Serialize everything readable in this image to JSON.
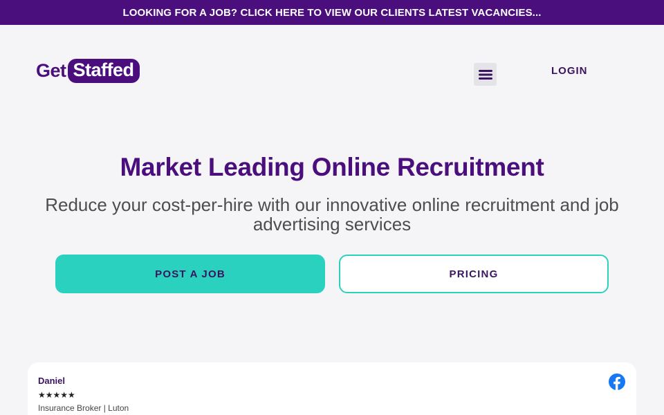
{
  "topbar": {
    "text": "LOOKING FOR A JOB? CLICK HERE TO VIEW OUR CLIENTS LATEST VACANCIES..."
  },
  "header": {
    "logo_part1": "Get",
    "logo_part2": "Staffed",
    "menu_icon": "hamburger-icon",
    "login_label": "LOGIN"
  },
  "hero": {
    "title": "Market Leading Online Recruitment",
    "subtitle": "Reduce your cost-per-hire with our innovative online recruitment and job advertising services",
    "primary_button": "POST A JOB",
    "secondary_button": "PRICING"
  },
  "review": {
    "name": "Daniel",
    "stars": "★★★★★",
    "role": "Insurance Broker | Luton",
    "source_icon": "facebook-icon"
  },
  "colors": {
    "brand_purple": "#4a0f7d",
    "accent_teal": "#2ad1bf",
    "facebook_blue": "#1877f2"
  }
}
